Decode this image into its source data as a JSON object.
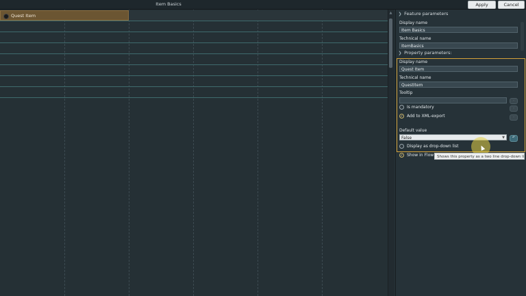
{
  "window": {
    "title": "Item Basics",
    "apply_label": "Apply",
    "cancel_label": "Cancel"
  },
  "grid": {
    "first_row_label": "Quest Item"
  },
  "feature_parameters": {
    "header": "Feature parameters",
    "display_name_label": "Display name",
    "display_name_value": "Item Basics",
    "technical_name_label": "Technical name",
    "technical_name_value": "ItemBasics"
  },
  "property_parameters": {
    "header": "Property parameters:",
    "display_name_label": "Display name",
    "display_name_value": "Quest Item",
    "technical_name_label": "Technical name",
    "technical_name_value": "QuestItem",
    "tooltip_label": "Tooltip",
    "tooltip_value": "",
    "is_mandatory_label": "Is mandatory",
    "is_mandatory_checked": false,
    "xml_export_label": "Add to XML-export",
    "xml_export_checked": true,
    "default_value_label": "Default value",
    "default_value": "False"
  },
  "extra_options": {
    "dropdown_label": "Display as drop-down list",
    "dropdown_checked": false,
    "show_in_flow_label": "Show in Flow",
    "show_in_flow_checked": true
  },
  "tooltip_popup": "Shows this property as a two line drop-down list.",
  "colors": {
    "accent": "#d7a43a",
    "selected_cell": "#6b5532",
    "background": "#263238"
  }
}
